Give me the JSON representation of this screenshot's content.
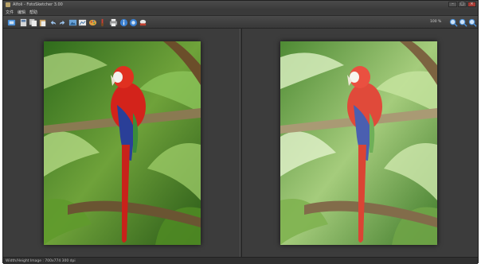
{
  "window": {
    "title": "Alfoli - FotoSketcher 3.00",
    "minimize_glyph": "–",
    "maximize_glyph": "□",
    "close_glyph": "×"
  },
  "menu": {
    "items": [
      "文件",
      "编辑",
      "帮助"
    ]
  },
  "toolbar": {
    "buttons": [
      {
        "name": "open-icon",
        "color": "#4a90d9"
      },
      {
        "name": "save-icon",
        "color": "#d8d8d8"
      },
      {
        "name": "copy-icon",
        "color": "#d8d8d8"
      },
      {
        "name": "paste-icon",
        "color": "#d8d8d8"
      },
      {
        "name": "undo-icon",
        "color": "#9ec6f0"
      },
      {
        "name": "redo-icon",
        "color": "#9ec6f0"
      },
      {
        "name": "image-icon",
        "color": "#6aa3d8"
      },
      {
        "name": "drawing-icon",
        "color": "#6aa3d8"
      },
      {
        "name": "paint-palette-icon",
        "color": "#e0a040"
      },
      {
        "name": "brush-icon",
        "color": "#d04030"
      },
      {
        "name": "print-icon",
        "color": "#e0e0e0"
      },
      {
        "name": "info-icon",
        "color": "#3a7fd0"
      },
      {
        "name": "help-icon",
        "color": "#3a7fd0"
      },
      {
        "name": "about-icon",
        "color": "#e8e8e8"
      },
      {
        "name": "zoom-in-icon",
        "color": "#4a90d9"
      },
      {
        "name": "zoom-out-icon",
        "color": "#4a90d9"
      },
      {
        "name": "zoom-fit-icon",
        "color": "#4a90d9"
      }
    ],
    "zoom_label": "100 %"
  },
  "status": {
    "text": "Width/Height Image : 700x774    300 dpi"
  }
}
